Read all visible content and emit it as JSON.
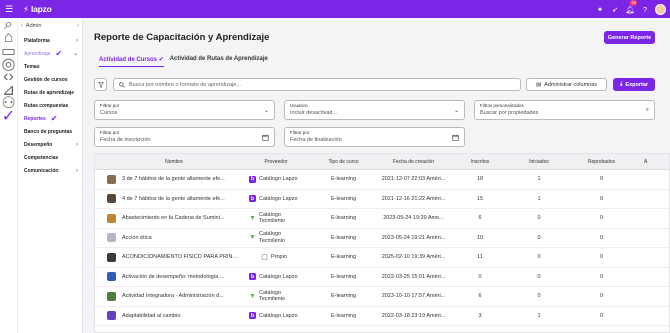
{
  "app": {
    "logo": "lapzo",
    "notif_count": "29"
  },
  "sidebar": {
    "back_label": "Admin",
    "items": [
      {
        "label": "Plataforma",
        "chevron": "›",
        "state": "normal"
      },
      {
        "label": "Aprendizaje",
        "chevron": "⌄",
        "state": "muted"
      },
      {
        "label": "Temas",
        "chevron": "",
        "state": "normal"
      },
      {
        "label": "Gestión de cursos",
        "chevron": "",
        "state": "normal"
      },
      {
        "label": "Rutas de aprendizaje",
        "chevron": "",
        "state": "normal"
      },
      {
        "label": "Rutas compuestas",
        "chevron": "",
        "state": "normal"
      },
      {
        "label": "Reportes",
        "chevron": "",
        "state": "active"
      },
      {
        "label": "Banco de preguntas",
        "chevron": "",
        "state": "normal"
      },
      {
        "label": "Desempeño",
        "chevron": "›",
        "state": "normal"
      },
      {
        "label": "Competencias",
        "chevron": "",
        "state": "normal"
      },
      {
        "label": "Comunicación",
        "chevron": "›",
        "state": "normal"
      }
    ]
  },
  "header": {
    "title": "Reporte de Capacitación y Aprendizaje",
    "generate_label": "Generar Reporte"
  },
  "tabs": [
    {
      "label": "Actividad de Cursos"
    },
    {
      "label": "Actividad de Rutas de Aprendizaje"
    }
  ],
  "toolbar": {
    "search_placeholder": "Busca por nombre o formato de aprendizaje...",
    "columns_label": "Administrar columnas",
    "export_label": "Exportar"
  },
  "filters": {
    "by": {
      "label": "Filtrar por",
      "value": "Cursos"
    },
    "users": {
      "label": "Usuarios",
      "value": "Incluir desactivad..."
    },
    "custom": {
      "label": "Filtros personalizados",
      "value": "Buscar por propiedades"
    },
    "start": {
      "label": "Filtrar por",
      "value": "Fecha de inscripción"
    },
    "end": {
      "label": "Filtrar por",
      "value": "Fecha de finalización"
    }
  },
  "table": {
    "headers": [
      "Nombre",
      "Proveedor",
      "Tipo de curso",
      "Fecha de creación",
      "Inscritos",
      "Iniciados",
      "Reprobados",
      "A"
    ],
    "rows": [
      {
        "name": "3 de 7 hábitos de la gente altamente efe...",
        "provider": "Catálogo Lapzo",
        "pkind": "lapzo",
        "type": "E-learning",
        "date": "2021-12-07 22:03 Améri...",
        "inscritos": "18",
        "iniciados": "1",
        "reprobados": "0",
        "thumb": "#8a6b4f"
      },
      {
        "name": "4 de 7 hábitos de la gente altamente efe...",
        "provider": "Catálogo Lapzo",
        "pkind": "lapzo",
        "type": "E-learning",
        "date": "2021-12-16 21:22 Améri...",
        "inscritos": "15",
        "iniciados": "1",
        "reprobados": "0",
        "thumb": "#5a4638"
      },
      {
        "name": "Abastecimiento en la Cadena de Sumini...",
        "provider": "Catálogo Tecmilenio",
        "pkind": "tec",
        "type": "E-learning",
        "date": "2023-05-24 19:39 Ame...",
        "inscritos": "6",
        "iniciados": "0",
        "reprobados": "0",
        "thumb": "#c0862f"
      },
      {
        "name": "Acción ética",
        "provider": "Catálogo Tecmilenio",
        "pkind": "tec",
        "type": "E-learning",
        "date": "2023-05-24 19:21 Améri...",
        "inscritos": "10",
        "iniciados": "0",
        "reprobados": "0",
        "thumb": "#b9b3c9"
      },
      {
        "name": "ACONDICIONAMIENTO FISICO PARA PRINCI...",
        "provider": "Propio",
        "pkind": "own",
        "type": "E-learning",
        "date": "2025-02-10 19:39 Améri...",
        "inscritos": "11",
        "iniciados": "0",
        "reprobados": "0",
        "thumb": "#3a3a3a"
      },
      {
        "name": "Activación de desempeño: metodología ...",
        "provider": "Catálogo Lapzo",
        "pkind": "lapzo",
        "type": "E-learning",
        "date": "2022-03-25 15:01 Améri...",
        "inscritos": "0",
        "iniciados": "0",
        "reprobados": "0",
        "thumb": "#2f5fb3"
      },
      {
        "name": "Actividad Integradora - Administración d...",
        "provider": "Catálogo Tecmilenio",
        "pkind": "tec",
        "type": "E-learning",
        "date": "2023-10-10 17:57 Améri...",
        "inscritos": "6",
        "iniciados": "0",
        "reprobados": "0",
        "thumb": "#4f7b3b"
      },
      {
        "name": "Adaptabilidad al cambio",
        "provider": "Catálogo Lapzo",
        "pkind": "lapzo",
        "type": "E-learning",
        "date": "2022-03-18 23:19 Améri...",
        "inscritos": "3",
        "iniciados": "1",
        "reprobados": "0",
        "thumb": "#6a3fc1"
      }
    ]
  },
  "colors": {
    "accent": "#7b25e6",
    "tecmilenio": "#58b947"
  }
}
